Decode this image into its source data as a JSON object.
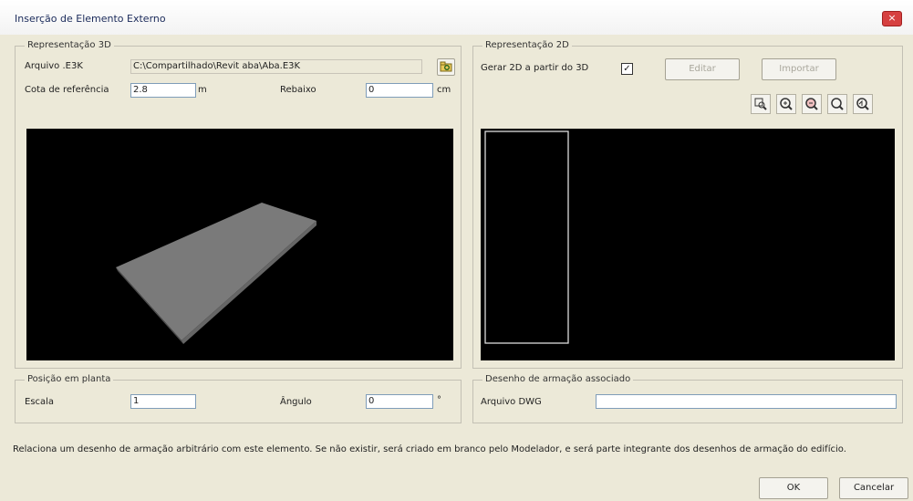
{
  "window": {
    "title": "Inserção de Elemento Externo",
    "close_glyph": "×"
  },
  "rep3d": {
    "legend": "Representação 3D",
    "file_label": "Arquivo .E3K",
    "file_value": "C:\\Compartilhado\\Revit aba\\Aba.E3K",
    "browse_icon": "folder-icon",
    "cota_label": "Cota de referência",
    "cota_value": "2.8",
    "cota_unit": "m",
    "rebaixo_label": "Rebaixo",
    "rebaixo_value": "0",
    "rebaixo_unit": "cm"
  },
  "rep2d": {
    "legend": "Representação 2D",
    "gerar_label": "Gerar 2D a partir do 3D",
    "gerar_checked": "✓",
    "editar_label": "Editar",
    "importar_label": "Importar",
    "tools": [
      "zoom-window-icon",
      "zoom-in-icon",
      "zoom-out-icon",
      "zoom-extents-icon",
      "zoom-previous-icon"
    ]
  },
  "posicao": {
    "legend": "Posição em planta",
    "escala_label": "Escala",
    "escala_value": "1",
    "angulo_label": "Ângulo",
    "angulo_value": "0",
    "angulo_unit": "°"
  },
  "desenho": {
    "legend": "Desenho de armação associado",
    "dwg_label": "Arquivo DWG",
    "dwg_value": ""
  },
  "help_text": "Relaciona um desenho de armação arbitrário com este elemento. Se não existir, será criado em branco pelo Modelador, e será parte integrante dos desenhos de armação do edifício.",
  "buttons": {
    "ok": "OK",
    "cancel": "Cancelar"
  },
  "colors": {
    "viewport_bg": "#000000",
    "solid_gray": "#7a7a7a",
    "outline": "#dcdcdc"
  }
}
